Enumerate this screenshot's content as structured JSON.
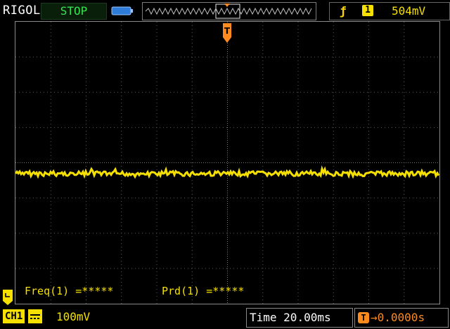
{
  "top": {
    "brand": "RIGOL",
    "run_state": "STOP",
    "trigger": {
      "edge_icon": "rising-edge-icon",
      "channel": "1",
      "level": "504mV"
    }
  },
  "measurements": {
    "freq": "Freq(1) =*****",
    "prd": "Prd(1) =*****"
  },
  "bottom": {
    "channel_label": "CH1",
    "channel_scale": "100mV",
    "time_label": "Time",
    "time_value": "20.00ms",
    "trigger_offset": "0.0000s"
  },
  "colors": {
    "channel1": "#f5e000",
    "trigger": "#ff8a1e",
    "run_state": "#32e650",
    "grid": "#5a5a5a"
  },
  "icons": [
    "battery-icon",
    "trigger-position-marker-icon",
    "channel1-ground-marker-icon",
    "dc-coupling-icon",
    "trigger-offset-icon"
  ]
}
